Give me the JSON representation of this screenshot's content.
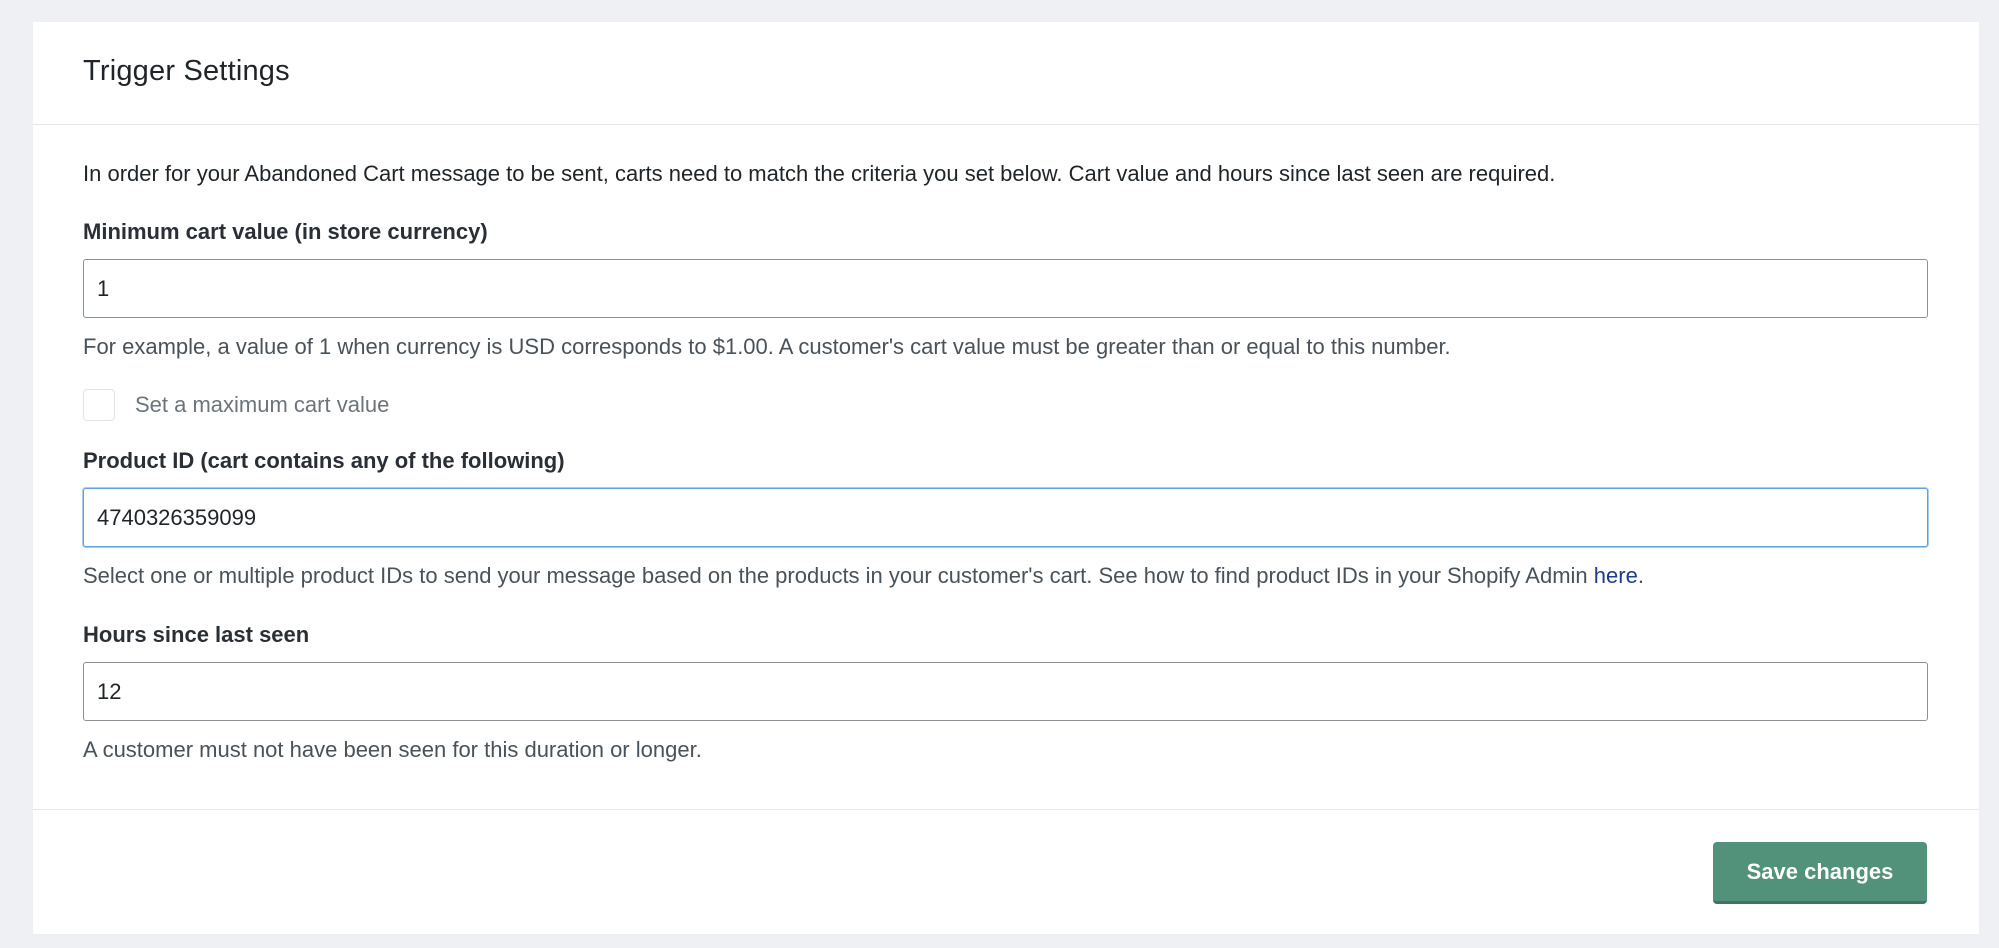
{
  "card": {
    "title": "Trigger Settings"
  },
  "intro_text": "In order for your Abandoned Cart message to be sent, carts need to match the criteria you set below. Cart value and hours since last seen are required.",
  "min_cart": {
    "label": "Minimum cart value (in store currency)",
    "value": "1",
    "help": "For example, a value of 1 when currency is USD corresponds to $1.00. A customer's cart value must be greater than or equal to this number."
  },
  "max_cart_checkbox": {
    "label": "Set a maximum cart value",
    "checked": false
  },
  "product_id": {
    "label": "Product ID (cart contains any of the following)",
    "value": "4740326359099",
    "help_prefix": "Select one or multiple product IDs to send your message based on the products in your customer's cart. See how to find product IDs in your Shopify Admin ",
    "help_link": "here",
    "help_suffix": "."
  },
  "hours": {
    "label": "Hours since last seen",
    "value": "12",
    "help": "A customer must not have been seen for this duration or longer."
  },
  "footer": {
    "save_label": "Save changes"
  },
  "colors": {
    "accent": "#52917a",
    "focus": "#5fa2e0",
    "link": "#1f3d8a"
  }
}
